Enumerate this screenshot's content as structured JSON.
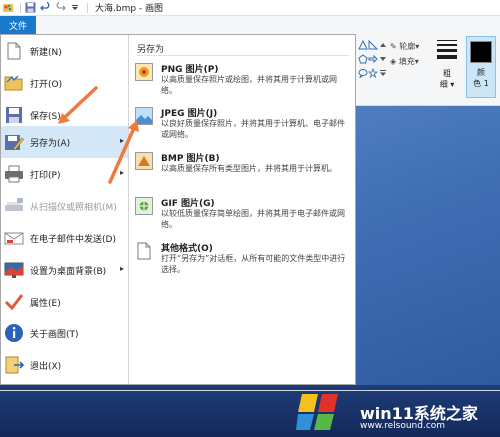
{
  "window": {
    "title": "大海.bmp - 画图",
    "file_tab": "文件"
  },
  "ribbon": {
    "outline_label": "轮廓",
    "fill_label": "填充",
    "stroke_label_line1": "粗",
    "stroke_label_line2": "细",
    "color1_label_line1": "颜",
    "color1_label_line2": "色 1"
  },
  "menu": {
    "items": [
      {
        "label": "新建(N)",
        "icon": "new-icon"
      },
      {
        "label": "打开(O)",
        "icon": "open-icon"
      },
      {
        "label": "保存(S)",
        "icon": "save-icon"
      },
      {
        "label": "另存为(A)",
        "icon": "save-as-icon",
        "submenu": true,
        "active": true
      },
      {
        "label": "打印(P)",
        "icon": "print-icon",
        "submenu": true
      },
      {
        "label": "从扫描仪或照相机(M)",
        "icon": "scanner-icon",
        "disabled": true
      },
      {
        "label": "在电子邮件中发送(D)",
        "icon": "email-icon"
      },
      {
        "label": "设置为桌面背景(B)",
        "icon": "desktop-background-icon",
        "submenu": true
      },
      {
        "label": "属性(E)",
        "icon": "properties-icon"
      },
      {
        "label": "关于画图(T)",
        "icon": "about-icon"
      },
      {
        "label": "退出(X)",
        "icon": "exit-icon"
      }
    ]
  },
  "save_as": {
    "heading": "另存为",
    "items": [
      {
        "title": "PNG 图片(P)",
        "desc": "以高质量保存照片或绘图，并将其用于计算机或网络。",
        "icon": "png-icon"
      },
      {
        "title": "JPEG 图片(J)",
        "desc": "以良好质量保存照片，并将其用于计算机、电子邮件或网络。",
        "icon": "jpeg-icon"
      },
      {
        "title": "BMP 图片(B)",
        "desc": "以高质量保存所有类型图片，并将其用于计算机。",
        "icon": "bmp-icon"
      },
      {
        "title": "GIF 图片(G)",
        "desc": "以较低质量保存简单绘图，并将其用于电子邮件或网络。",
        "icon": "gif-icon"
      },
      {
        "title": "其他格式(O)",
        "desc": "打开“另存为”对话框，从所有可能的文件类型中进行选择。",
        "icon": "other-formats-icon"
      }
    ]
  },
  "watermark": {
    "text": "win11系统之家",
    "url": "www.relsound.com"
  },
  "colors": {
    "accent": "#1979ca",
    "highlight": "#d5e8f7",
    "arrow": "#f07a3c"
  }
}
